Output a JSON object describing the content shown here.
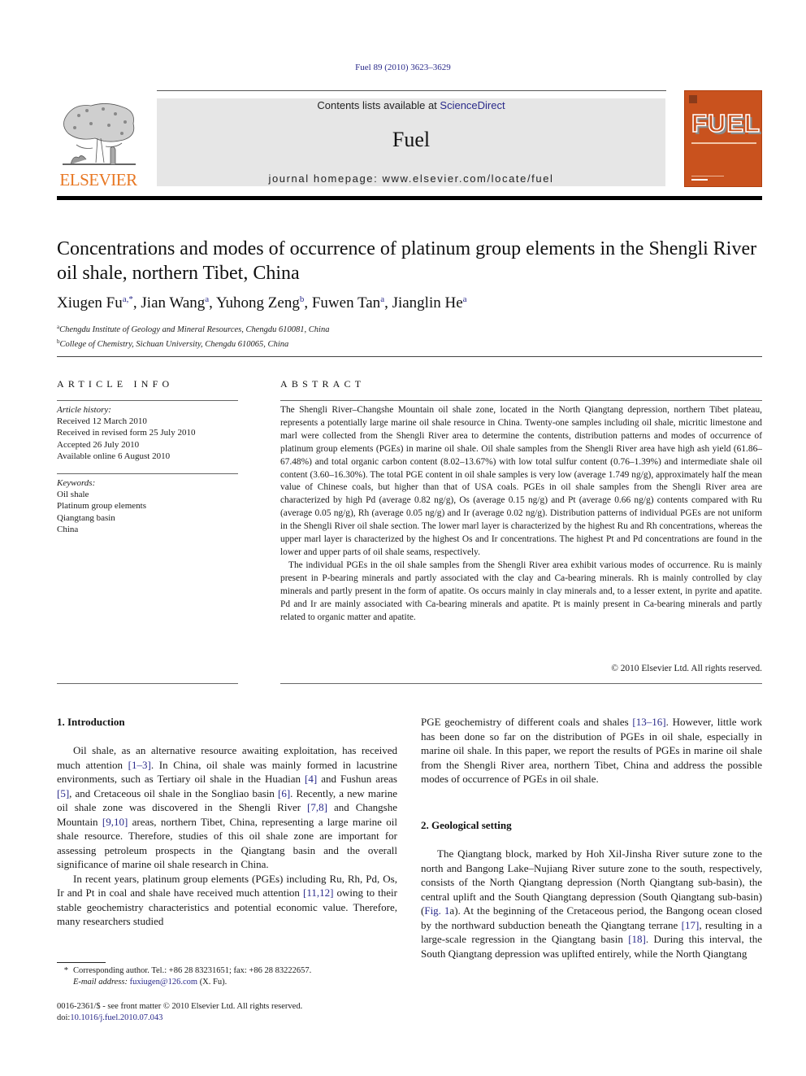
{
  "header": {
    "citation": "Fuel 89 (2010) 3623–3629",
    "contents_prefix": "Contents lists available at ",
    "contents_link": "ScienceDirect",
    "journal_name": "Fuel",
    "homepage_label": "journal homepage: www.elsevier.com/locate/fuel",
    "publisher_wordmark": "ELSEVIER",
    "cover_title": "FUEL",
    "colors": {
      "elsevier_orange": "#e87722",
      "cover_orange": "#c9521e",
      "link_blue": "#2a2a8a"
    }
  },
  "article": {
    "title": "Concentrations and modes of occurrence of platinum group elements in the Shengli River oil shale, northern Tibet, China",
    "authors": [
      {
        "name": "Xiugen Fu",
        "sup": "a,*"
      },
      {
        "name": "Jian Wang",
        "sup": "a"
      },
      {
        "name": "Yuhong Zeng",
        "sup": "b"
      },
      {
        "name": "Fuwen Tan",
        "sup": "a"
      },
      {
        "name": "Jianglin He",
        "sup": "a"
      }
    ],
    "affiliations": [
      {
        "key": "a",
        "text": "Chengdu Institute of Geology and Mineral Resources, Chengdu 610081, China"
      },
      {
        "key": "b",
        "text": "College of Chemistry, Sichuan University, Chengdu 610065, China"
      }
    ]
  },
  "article_info": {
    "heading": "ARTICLE INFO",
    "history_label": "Article history:",
    "history": [
      "Received 12 March 2010",
      "Received in revised form 25 July 2010",
      "Accepted 26 July 2010",
      "Available online 6 August 2010"
    ],
    "keywords_label": "Keywords:",
    "keywords": [
      "Oil shale",
      "Platinum group elements",
      "Qiangtang basin",
      "China"
    ]
  },
  "abstract": {
    "heading": "ABSTRACT",
    "paragraphs": [
      "The Shengli River–Changshe Mountain oil shale zone, located in the North Qiangtang depression, northern Tibet plateau, represents a potentially large marine oil shale resource in China. Twenty-one samples including oil shale, micritic limestone and marl were collected from the Shengli River area to determine the contents, distribution patterns and modes of occurrence of platinum group elements (PGEs) in marine oil shale. Oil shale samples from the Shengli River area have high ash yield (61.86–67.48%) and total organic carbon content (8.02–13.67%) with low total sulfur content (0.76–1.39%) and intermediate shale oil content (3.60–16.30%). The total PGE content in oil shale samples is very low (average 1.749 ng/g), approximately half the mean value of Chinese coals, but higher than that of USA coals. PGEs in oil shale samples from the Shengli River area are characterized by high Pd (average 0.82 ng/g), Os (average 0.15 ng/g) and Pt (average 0.66 ng/g) contents compared with Ru (average 0.05 ng/g), Rh (average 0.05 ng/g) and Ir (average 0.02 ng/g). Distribution patterns of individual PGEs are not uniform in the Shengli River oil shale section. The lower marl layer is characterized by the highest Ru and Rh concentrations, whereas the upper marl layer is characterized by the highest Os and Ir concentrations. The highest Pt and Pd concentrations are found in the lower and upper parts of oil shale seams, respectively.",
      "The individual PGEs in the oil shale samples from the Shengli River area exhibit various modes of occurrence. Ru is mainly present in P-bearing minerals and partly associated with the clay and Ca-bearing minerals. Rh is mainly controlled by clay minerals and partly present in the form of apatite. Os occurs mainly in clay minerals and, to a lesser extent, in pyrite and apatite. Pd and Ir are mainly associated with Ca-bearing minerals and apatite. Pt is mainly present in Ca-bearing minerals and partly related to organic matter and apatite."
    ],
    "copyright": "© 2010 Elsevier Ltd. All rights reserved."
  },
  "sections": {
    "introduction": {
      "heading": "1. Introduction",
      "p1": [
        {
          "t": "Oil shale, as an alternative resource awaiting exploitation, has received much attention "
        },
        {
          "ref": "[1–3]"
        },
        {
          "t": ". In China, oil shale was mainly formed in lacustrine environments, such as Tertiary oil shale in the Huadian "
        },
        {
          "ref": "[4]"
        },
        {
          "t": " and Fushun areas "
        },
        {
          "ref": "[5]"
        },
        {
          "t": ", and Cretaceous oil shale in the Songliao basin "
        },
        {
          "ref": "[6]"
        },
        {
          "t": ". Recently, a new marine oil shale zone was discovered in the Shengli River "
        },
        {
          "ref": "[7,8]"
        },
        {
          "t": " and Changshe Mountain "
        },
        {
          "ref": "[9,10]"
        },
        {
          "t": " areas, northern Tibet, China, representing a large marine oil shale resource. Therefore, studies of this oil shale zone are important for assessing petroleum prospects in the Qiangtang basin and the overall significance of marine oil shale research in China."
        }
      ],
      "p2": [
        {
          "t": "In recent years, platinum group elements (PGEs) including Ru, Rh, Pd, Os, Ir and Pt in coal and shale have received much attention "
        },
        {
          "ref": "[11,12]"
        },
        {
          "t": " owing to their stable geochemistry characteristics and potential economic value. Therefore, many researchers studied "
        }
      ],
      "p2_cont": [
        {
          "t": "PGE geochemistry of different coals and shales "
        },
        {
          "ref": "[13–16]"
        },
        {
          "t": ". However, little work has been done so far on the distribution of PGEs in oil shale, especially in marine oil shale. In this paper, we report the results of PGEs in marine oil shale from the Shengli River area, northern Tibet, China and address the possible modes of occurrence of PGEs in oil shale."
        }
      ]
    },
    "geological_setting": {
      "heading": "2. Geological setting",
      "p1": [
        {
          "t": "The Qiangtang block, marked by Hoh Xil-Jinsha River suture zone to the north and Bangong Lake–Nujiang River suture zone to the south, respectively, consists of the North Qiangtang depression (North Qiangtang sub-basin), the central uplift and the South Qiangtang depression (South Qiangtang sub-basin) ("
        },
        {
          "ref": "Fig. 1"
        },
        {
          "t": "a). At the beginning of the Cretaceous period, the Bangong ocean closed by the northward subduction beneath the Qiangtang terrane "
        },
        {
          "ref": "[17]"
        },
        {
          "t": ", resulting in a large-scale regression in the Qiangtang basin "
        },
        {
          "ref": "[18]"
        },
        {
          "t": ". During this interval, the South Qiangtang depression was uplifted entirely, while the North Qiangtang"
        }
      ]
    }
  },
  "footnote": {
    "star": "*",
    "corresponding": "Corresponding author. Tel.: +86 28 83231651; fax: +86 28 83222657.",
    "email_label": "E-mail address:",
    "email": "fuxiugen@126.com",
    "email_suffix": " (X. Fu)."
  },
  "front_matter": {
    "issn_line": "0016-2361/$ - see front matter © 2010 Elsevier Ltd. All rights reserved.",
    "doi_label": "doi:",
    "doi": "10.1016/j.fuel.2010.07.043"
  }
}
